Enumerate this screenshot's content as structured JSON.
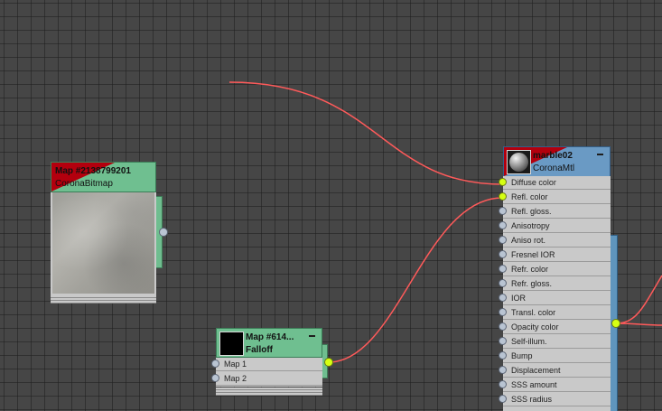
{
  "canvas": {
    "background": "#464646",
    "wire_color": "#ff5a5a"
  },
  "bitmap_node": {
    "title": "Map #2138799201",
    "type": "CoronaBitmap",
    "header_color": "#6fbf90",
    "accent_color": "#b3000e"
  },
  "falloff_node": {
    "title": "Map #614...",
    "type": "Falloff",
    "collapse_icon": "minus-icon",
    "slots": [
      {
        "label": "Map 1"
      },
      {
        "label": "Map 2"
      }
    ]
  },
  "material_node": {
    "title": "marble02",
    "type": "CoronaMtl",
    "header_color": "#6a9ac4",
    "collapse_icon": "minus-icon",
    "slots": [
      {
        "label": "Diffuse color",
        "connected": true
      },
      {
        "label": "Refl. color",
        "connected": true
      },
      {
        "label": "Refl. gloss.",
        "connected": false
      },
      {
        "label": "Anisotropy",
        "connected": false
      },
      {
        "label": "Aniso rot.",
        "connected": false
      },
      {
        "label": "Fresnel IOR",
        "connected": false
      },
      {
        "label": "Refr. color",
        "connected": false
      },
      {
        "label": "Refr. gloss.",
        "connected": false
      },
      {
        "label": "IOR",
        "connected": false
      },
      {
        "label": "Transl. color",
        "connected": false
      },
      {
        "label": "Opacity color",
        "connected": false
      },
      {
        "label": "Self-illum.",
        "connected": false
      },
      {
        "label": "Bump",
        "connected": false
      },
      {
        "label": "Displacement",
        "connected": false
      },
      {
        "label": "SSS amount",
        "connected": false
      },
      {
        "label": "SSS radius",
        "connected": false
      }
    ]
  }
}
